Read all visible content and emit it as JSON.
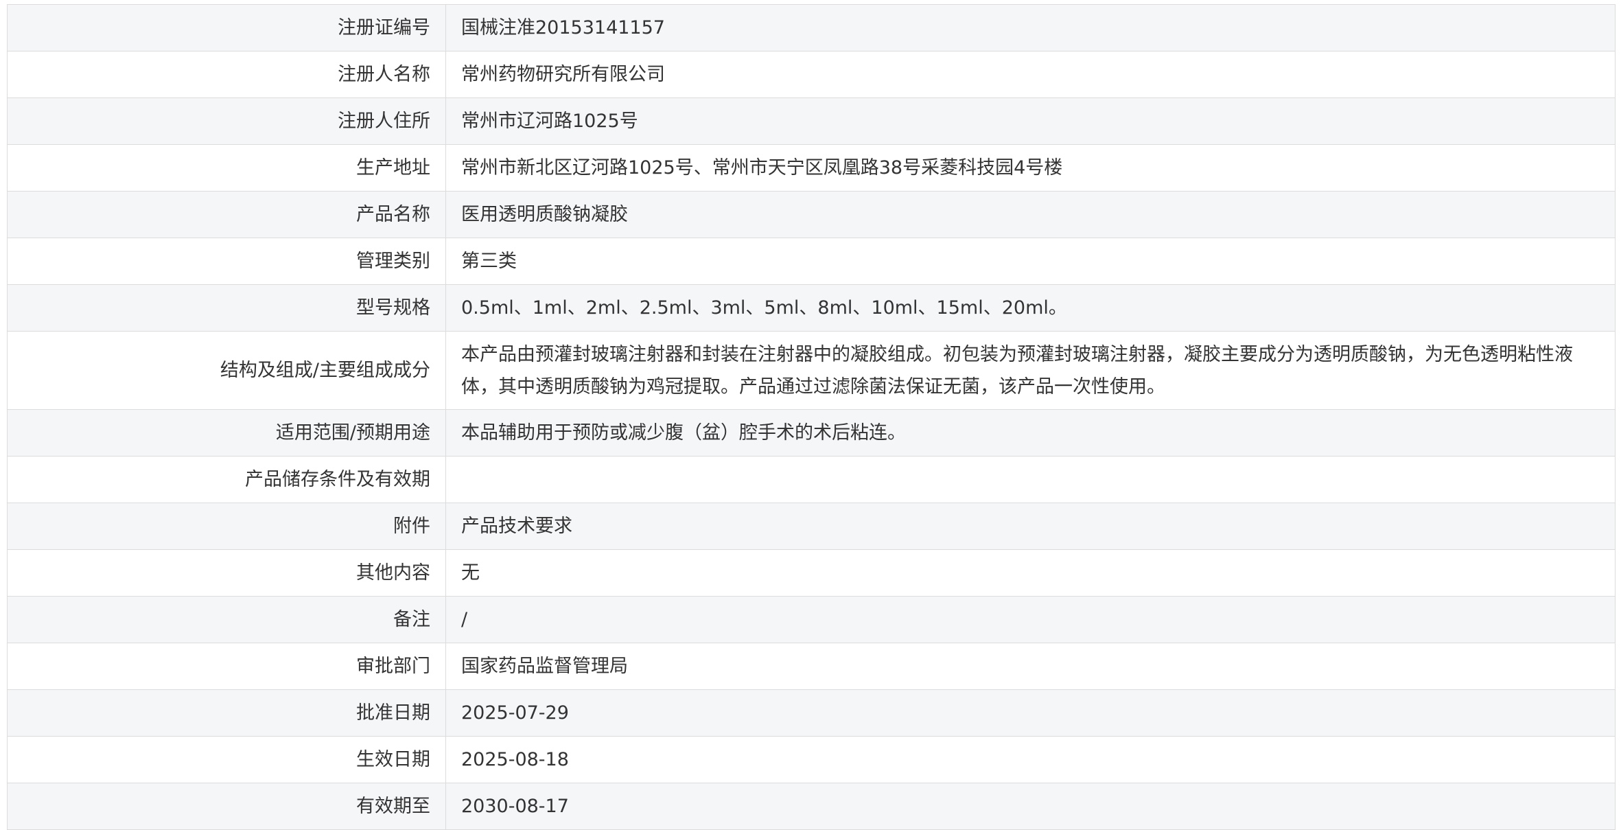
{
  "rows": [
    {
      "label": "注册证编号",
      "value": "国械注准20153141157"
    },
    {
      "label": "注册人名称",
      "value": "常州药物研究所有限公司"
    },
    {
      "label": "注册人住所",
      "value": "常州市辽河路1025号"
    },
    {
      "label": "生产地址",
      "value": "常州市新北区辽河路1025号、常州市天宁区凤凰路38号采菱科技园4号楼"
    },
    {
      "label": "产品名称",
      "value": "医用透明质酸钠凝胶"
    },
    {
      "label": "管理类别",
      "value": "第三类"
    },
    {
      "label": "型号规格",
      "value": "0.5ml、1ml、2ml、2.5ml、3ml、5ml、8ml、10ml、15ml、20ml。"
    },
    {
      "label": "结构及组成/主要组成成分",
      "value": "本产品由预灌封玻璃注射器和封装在注射器中的凝胶组成。初包装为预灌封玻璃注射器，凝胶主要成分为透明质酸钠，为无色透明粘性液体，其中透明质酸钠为鸡冠提取。产品通过过滤除菌法保证无菌，该产品一次性使用。"
    },
    {
      "label": "适用范围/预期用途",
      "value": "本品辅助用于预防或减少腹（盆）腔手术的术后粘连。"
    },
    {
      "label": "产品储存条件及有效期",
      "value": ""
    },
    {
      "label": "附件",
      "value": "产品技术要求"
    },
    {
      "label": "其他内容",
      "value": "无"
    },
    {
      "label": "备注",
      "value": "/"
    },
    {
      "label": "审批部门",
      "value": "国家药品监督管理局"
    },
    {
      "label": "批准日期",
      "value": "2025-07-29"
    },
    {
      "label": "生效日期",
      "value": "2025-08-18"
    },
    {
      "label": "有效期至",
      "value": "2030-08-17"
    }
  ]
}
